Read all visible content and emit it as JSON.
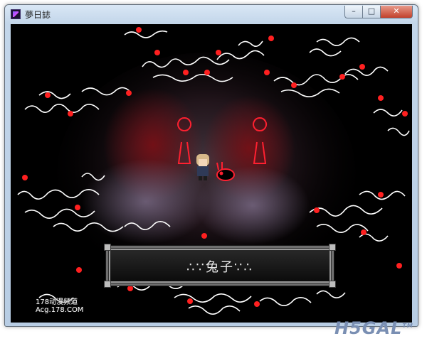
{
  "window": {
    "title": "夢日誌",
    "controls": {
      "minimize": "–",
      "maximize": "□",
      "close": "✕"
    }
  },
  "game": {
    "dialog_text": "∴∵兔子∵∴"
  },
  "watermarks": {
    "left_line1": "178动漫频道",
    "left_line2": "Acg.178.COM",
    "right": "H5GAL",
    "right_suffix": "TM"
  },
  "colors": {
    "background": "#000000",
    "vine": "#ffffff",
    "flower": "#ff2020",
    "outline_sprite": "#ff2030",
    "glow": "#7a0f15"
  },
  "icons": [
    "app-icon",
    "rose-icon",
    "rabbit-icon",
    "keyhole-icon"
  ]
}
